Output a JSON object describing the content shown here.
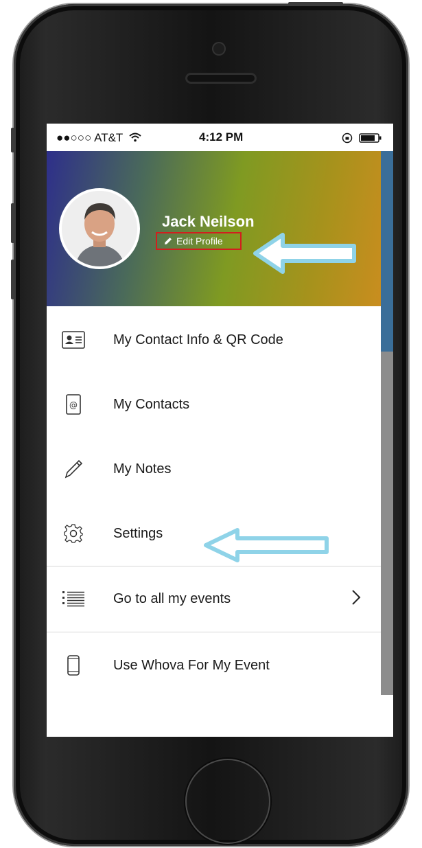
{
  "status_bar": {
    "carrier": "●●○○○ AT&T",
    "time": "4:12 PM"
  },
  "profile": {
    "name": "Jack Neilson",
    "edit_label": "Edit Profile"
  },
  "menu": {
    "items": [
      {
        "label": "My Contact Info & QR Code",
        "icon": "contact-card-icon"
      },
      {
        "label": "My Contacts",
        "icon": "contacts-book-icon"
      },
      {
        "label": "My Notes",
        "icon": "pencil-icon"
      },
      {
        "label": "Settings",
        "icon": "gear-icon"
      },
      {
        "label": "Go to all my events",
        "icon": "list-icon"
      },
      {
        "label": "Use Whova For My Event",
        "icon": "phone-icon"
      }
    ]
  },
  "colors": {
    "header_gradient": [
      "#2e2f8a",
      "#7f9a22",
      "#c98d1f"
    ],
    "highlight_border": "#d21e1e",
    "annotation_arrow": "#8fd3e8"
  }
}
